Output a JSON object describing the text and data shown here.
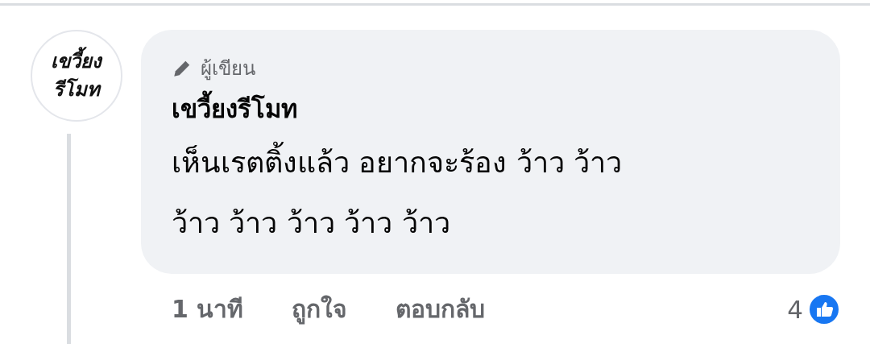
{
  "comment": {
    "avatar": {
      "lines": [
        "เขวี้ยง",
        "รีโมท"
      ]
    },
    "badge": "ผู้เขียน",
    "author": "เขวี้ยงรีโมท",
    "text_lines": [
      "เห็นเรตติ้งแล้ว อยากจะร้อง ว้าว ว้าว",
      "ว้าว ว้าว ว้าว ว้าว ว้าว"
    ],
    "time": "1 นาที",
    "actions": [
      "ถูกใจ",
      "ตอบกลับ"
    ],
    "reaction_count": "4"
  }
}
